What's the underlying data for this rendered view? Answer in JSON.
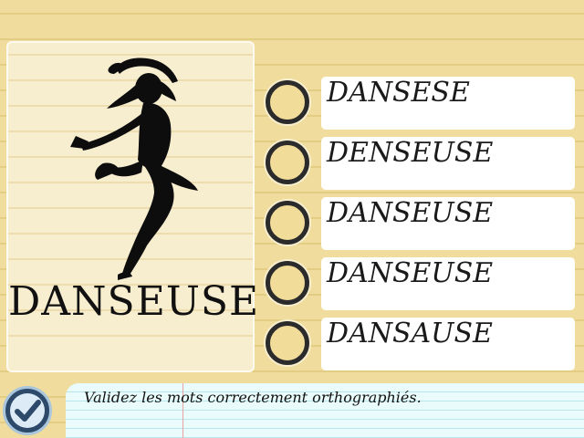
{
  "picture": {
    "word": "DANSEUSE",
    "image_subject": "dancer-silhouette"
  },
  "options": [
    {
      "label": "DANSESE",
      "selected": false
    },
    {
      "label": "DENSEUSE",
      "selected": false
    },
    {
      "label": "DANSEUSE",
      "selected": false
    },
    {
      "label": "DANSEUSE",
      "selected": false
    },
    {
      "label": "DANSAUSE",
      "selected": false
    }
  ],
  "footer": {
    "instruction": "Validez les mots correctement orthographiés.",
    "validate_icon": "checkmark-icon"
  },
  "colors": {
    "background": "#f0dc9c",
    "card": "#f7edcf",
    "radio_border": "#2b2b2b",
    "validate_button": "#2e4a6a",
    "footer_paper": "#e9fbfb"
  }
}
